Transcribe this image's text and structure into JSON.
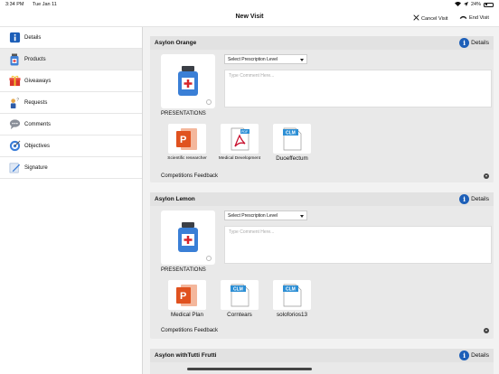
{
  "status_bar": {
    "time": "3:34 PM",
    "date": "Tue Jan 11",
    "battery": "24%"
  },
  "navbar": {
    "title": "New Visit",
    "cancel_label": "Cancel Visit",
    "end_label": "End Visit"
  },
  "sidebar": {
    "items": [
      {
        "label": "Details",
        "icon": "info-icon"
      },
      {
        "label": "Products",
        "icon": "bottle-icon",
        "active": true
      },
      {
        "label": "Giveaways",
        "icon": "gift-icon"
      },
      {
        "label": "Requests",
        "icon": "request-icon"
      },
      {
        "label": "Comments",
        "icon": "comment-icon"
      },
      {
        "label": "Objectives",
        "icon": "objective-icon"
      },
      {
        "label": "Signature",
        "icon": "signature-icon"
      }
    ]
  },
  "products": [
    {
      "name": "Asylon Orange",
      "details_label": "Details",
      "prescription_select": "Select Prescription Level",
      "comment_placeholder": "Type Comment Here...",
      "presentations_label": "PRESENTATIONS",
      "presentations": [
        {
          "type": "ppt",
          "title": "Scientific researcher"
        },
        {
          "type": "pdf",
          "title": "Medical Development"
        },
        {
          "type": "clm",
          "title": "Duoeffectum"
        }
      ],
      "feedback_label": "Competitions Feedback"
    },
    {
      "name": "Asylon Lemon",
      "details_label": "Details",
      "prescription_select": "Select Prescription Level",
      "comment_placeholder": "Type Comment Here...",
      "presentations_label": "PRESENTATIONS",
      "presentations": [
        {
          "type": "ppt",
          "title": "Medical Plan"
        },
        {
          "type": "clm",
          "title": "Corntears"
        },
        {
          "type": "clm",
          "title": "soloforios13"
        }
      ],
      "feedback_label": "Competitions Feedback"
    },
    {
      "name": "Asylon withTutti Frutti",
      "details_label": "Details"
    }
  ],
  "colors": {
    "accent": "#1d5fb8",
    "ppt": "#e0521f",
    "pdf": "#c8102e",
    "clm": "#2d8fd5"
  }
}
